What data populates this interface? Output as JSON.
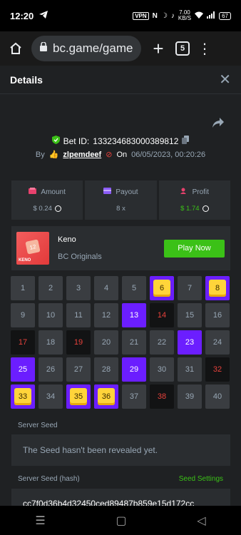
{
  "status_bar": {
    "time": "12:20",
    "vpn": "VPN",
    "nfc": "N",
    "net_speed_value": "7.00",
    "net_speed_unit": "KB/S",
    "battery": "67"
  },
  "browser": {
    "url": "bc.game/game",
    "tab_count": "5"
  },
  "details": {
    "title": "Details"
  },
  "bet": {
    "id_label": "Bet ID:",
    "id": "133234683000389812",
    "by_label": "By",
    "user": "zlpemdeef",
    "on_label": "On",
    "date": "06/05/2023, 00:20:26"
  },
  "stats": [
    {
      "label": "Amount",
      "value": "$ 0.24",
      "icon": "amount-icon"
    },
    {
      "label": "Payout",
      "value": "8 x",
      "icon": "payout-icon"
    },
    {
      "label": "Profit",
      "value": "$ 1.74",
      "icon": "profit-icon"
    }
  ],
  "game": {
    "name": "Keno",
    "provider": "BC Originals",
    "play_button": "Play Now",
    "thumb_tile": "12",
    "thumb_text": "KENO"
  },
  "grid": [
    {
      "n": "1",
      "s": "idle"
    },
    {
      "n": "2",
      "s": "idle"
    },
    {
      "n": "3",
      "s": "idle"
    },
    {
      "n": "4",
      "s": "idle"
    },
    {
      "n": "5",
      "s": "idle"
    },
    {
      "n": "6",
      "s": "hit"
    },
    {
      "n": "7",
      "s": "idle"
    },
    {
      "n": "8",
      "s": "hit"
    },
    {
      "n": "9",
      "s": "idle"
    },
    {
      "n": "10",
      "s": "idle"
    },
    {
      "n": "11",
      "s": "idle"
    },
    {
      "n": "12",
      "s": "idle"
    },
    {
      "n": "13",
      "s": "sel"
    },
    {
      "n": "14",
      "s": "miss"
    },
    {
      "n": "15",
      "s": "idle"
    },
    {
      "n": "16",
      "s": "idle"
    },
    {
      "n": "17",
      "s": "miss"
    },
    {
      "n": "18",
      "s": "idle"
    },
    {
      "n": "19",
      "s": "miss"
    },
    {
      "n": "20",
      "s": "idle"
    },
    {
      "n": "21",
      "s": "idle"
    },
    {
      "n": "22",
      "s": "idle"
    },
    {
      "n": "23",
      "s": "sel"
    },
    {
      "n": "24",
      "s": "idle"
    },
    {
      "n": "25",
      "s": "sel"
    },
    {
      "n": "26",
      "s": "idle"
    },
    {
      "n": "27",
      "s": "idle"
    },
    {
      "n": "28",
      "s": "idle"
    },
    {
      "n": "29",
      "s": "sel"
    },
    {
      "n": "30",
      "s": "idle"
    },
    {
      "n": "31",
      "s": "idle"
    },
    {
      "n": "32",
      "s": "miss"
    },
    {
      "n": "33",
      "s": "hit"
    },
    {
      "n": "34",
      "s": "idle"
    },
    {
      "n": "35",
      "s": "hit"
    },
    {
      "n": "36",
      "s": "hit"
    },
    {
      "n": "37",
      "s": "idle"
    },
    {
      "n": "38",
      "s": "miss"
    },
    {
      "n": "39",
      "s": "idle"
    },
    {
      "n": "40",
      "s": "idle"
    }
  ],
  "seeds": {
    "server_seed_label": "Server Seed",
    "server_seed_value": "The Seed hasn't been revealed yet.",
    "hash_label": "Server Seed (hash)",
    "settings_link": "Seed Settings",
    "hash_value": "cc7f0d36b4d32450ced89487b859e15d172cc"
  },
  "colors": {
    "accent_green": "#3bc117",
    "selected_purple": "#6b1eff",
    "hit_gold": "#ffd43a",
    "miss_red": "#e7413b"
  }
}
